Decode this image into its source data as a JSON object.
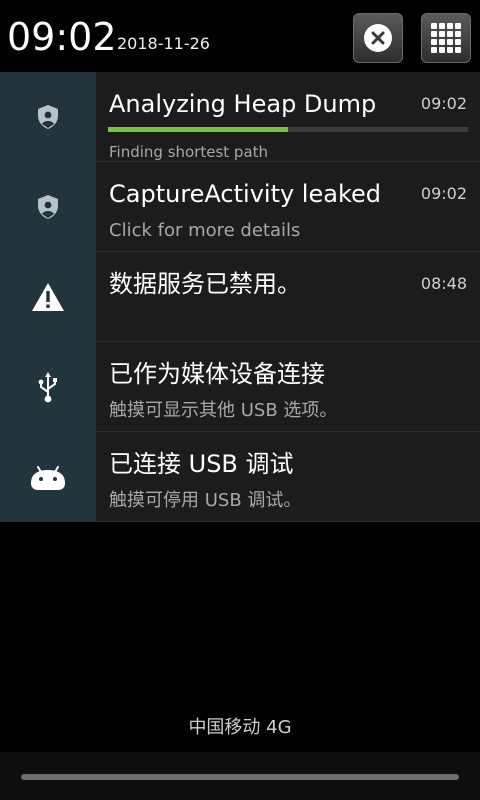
{
  "header": {
    "time": "09:02",
    "date": "2018-11-26",
    "clear_icon": "close-x-icon",
    "settings_icon": "grid-apps-icon"
  },
  "notifications": [
    {
      "icon": "leakcanary-shield-icon",
      "title": "Analyzing Heap Dump",
      "time": "09:02",
      "progress_percent": 50,
      "subtitle": "Finding shortest path"
    },
    {
      "icon": "leakcanary-shield-icon",
      "title": "CaptureActivity leaked",
      "time": "09:02",
      "subtitle": "Click for more details"
    },
    {
      "icon": "warning-triangle-icon",
      "title": "数据服务已禁用。",
      "time": "08:48",
      "subtitle": ""
    },
    {
      "icon": "usb-icon",
      "title": "已作为媒体设备连接",
      "time": "",
      "subtitle": "触摸可显示其他 USB 选项。"
    },
    {
      "icon": "android-debug-icon",
      "title": "已连接 USB 调试",
      "time": "",
      "subtitle": "触摸可停用 USB 调试。"
    }
  ],
  "footer": {
    "carrier": "中国移动 4G"
  },
  "colors": {
    "icon_cell_bg": "#22343c",
    "notif_bg": "#1c1c1c",
    "progress_fill": "#7bc23e",
    "progress_track": "#3b3b3b"
  }
}
